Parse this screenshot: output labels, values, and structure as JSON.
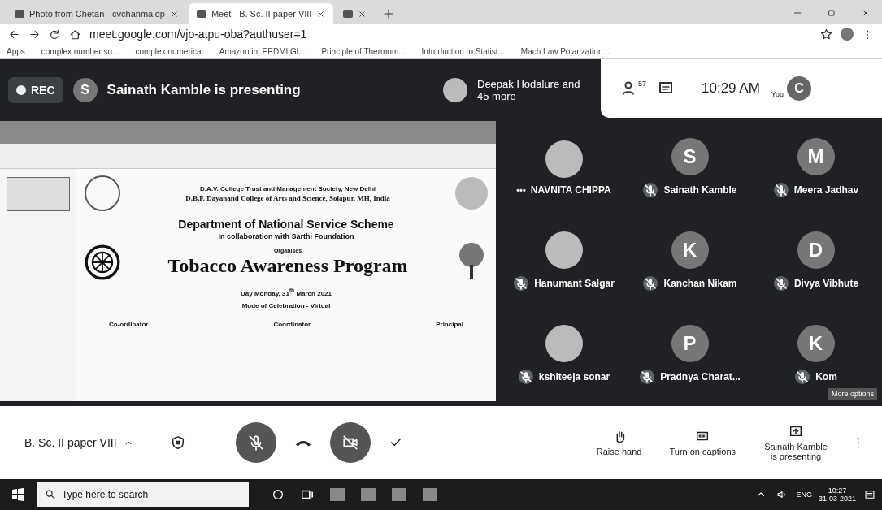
{
  "browser": {
    "tabs": [
      {
        "title": "Photo from Chetan - cvchanmaidp",
        "selected": false
      },
      {
        "title": "Meet - B. Sc. II paper VIII",
        "selected": true
      },
      {
        "selected": false
      }
    ],
    "address": "meet.google.com/vjo-atpu-oba?authuser=1",
    "bookmarks": [
      {
        "label": "Apps"
      },
      {
        "label": "complex number su..."
      },
      {
        "label": "complex numerical"
      },
      {
        "label": "Amazon.in: EEDMI Gl..."
      },
      {
        "label": "Principle of Thermom..."
      },
      {
        "label": "Introduction to Statist..."
      },
      {
        "label": "Mach Law Polarization..."
      }
    ]
  },
  "meet": {
    "rec_label": "REC",
    "presenter_initial": "S",
    "presenter_text": "Sainath Kamble is presenting",
    "others": "Deepak Hodalure and 45 more",
    "people_count": "57",
    "time": "10:29 AM",
    "you_label": "You",
    "you_initial": "C",
    "slide": {
      "society": "D.A.V. College Trust and Management Society, New Delhi",
      "college": "D.B.F. Dayanand College of Arts and Science, Solapur, MH, India",
      "department": "Department of National Service Scheme",
      "collab": "In collaboration with Sarthi Foundation",
      "organises": "Organises",
      "title": "Tobacco Awareness Program",
      "day": "Day Monday, 31$^{th}$ March 2021",
      "mode": "Mode of Celebration - Virtual",
      "signatories": [
        {
          "role": "Co-ordinator"
        },
        {
          "role": "Coordinator"
        },
        {
          "role": "Principal"
        }
      ]
    },
    "participants": [
      {
        "name": "NAVNITA CHIPPA",
        "kind": "photo",
        "menu": "•••"
      },
      {
        "name": "Sainath Kamble",
        "kind": "letter",
        "initial": "S",
        "muted": true
      },
      {
        "name": "Meera Jadhav",
        "kind": "letter",
        "initial": "M",
        "muted": true
      },
      {
        "name": "Hanumant Salgar",
        "kind": "photo",
        "muted": true
      },
      {
        "name": "Kanchan Nikam",
        "kind": "letter",
        "initial": "K",
        "muted": true
      },
      {
        "name": "Divya Vibhute",
        "kind": "letter",
        "initial": "D",
        "muted": true
      },
      {
        "name": "kshiteeja sonar",
        "kind": "photo",
        "muted": true
      },
      {
        "name": "Pradnya Charat...",
        "kind": "letter",
        "initial": "P",
        "muted": true
      },
      {
        "name": "Kom",
        "kind": "letter",
        "initial": "K",
        "muted": true
      }
    ],
    "tooltip": "More options"
  },
  "controls": {
    "meeting_title": "B. Sc. II paper VIII",
    "mic_on": false,
    "camera_on": false,
    "raise_hand": "Raise hand",
    "captions": "Turn on captions",
    "presenting": "Sainath Kamble is presenting"
  },
  "taskbar": {
    "search_placeholder": "Type here to search",
    "language": "ENG",
    "time": "10:27",
    "date": "31-03-2021"
  }
}
